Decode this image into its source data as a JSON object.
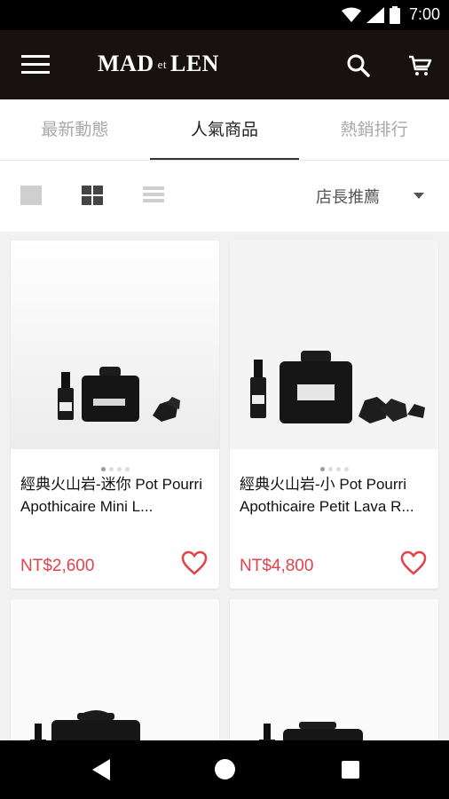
{
  "status_bar": {
    "time": "7:00"
  },
  "header": {
    "brand_left": "MAD",
    "brand_mid": "et",
    "brand_right": "LEN"
  },
  "tabs": [
    {
      "label": "最新動態",
      "active": false
    },
    {
      "label": "人氣商品",
      "active": true
    },
    {
      "label": "熱銷排行",
      "active": false
    }
  ],
  "toolbar": {
    "sort_label": "店長推薦"
  },
  "products": [
    {
      "title": "經典火山岩-迷你 Pot Pourri Apothicaire Mini L...",
      "price": "NT$2,600"
    },
    {
      "title": "經典火山岩-小 Pot Pourri Apothicaire Petit Lava R...",
      "price": "NT$4,800"
    },
    {
      "title": "",
      "price": ""
    },
    {
      "title": "",
      "price": ""
    }
  ],
  "colors": {
    "price": "#e0434b",
    "app_bar": "#17110f",
    "accent_heart": "#e0434b"
  },
  "icons": [
    "wifi-icon",
    "signal-icon",
    "battery-icon",
    "menu-icon",
    "search-icon",
    "cart-icon",
    "heart-icon",
    "back-icon",
    "home-icon",
    "recents-icon"
  ]
}
